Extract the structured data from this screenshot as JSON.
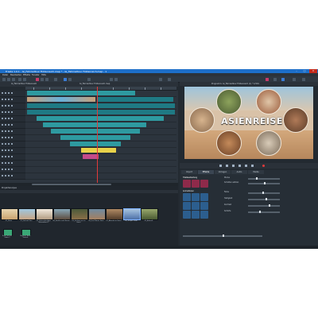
{
  "window": {
    "title": "Frieda 1.0.1 - Gi_Fahrradtour Fiddenreich.mep * - Gi_Fahrradtour Fiddenreich.mep - 1",
    "minimize": "–",
    "maximize": "□",
    "close": "✕"
  },
  "menu": [
    "Datei",
    "Bearbeiten",
    "Effekte",
    "Fenster",
    "Hilfe"
  ],
  "timeline": {
    "file_left": "Gi_Fahrradtour Fiddenreich",
    "file_center": "Gi_Fahrradtour Fiddenreich.mep"
  },
  "preview": {
    "header": "Programm: Gi_Fahrradtour Fiddenreich (1) * 1/501",
    "title_text": "ASIENREISE"
  },
  "project": {
    "title": "Projektanalyse",
    "media": [
      {
        "label": "01_Reise"
      },
      {
        "label": "02_Fahrrad Tour"
      },
      {
        "label": "03_Schneckenjäger Fahrradtour 1"
      },
      {
        "label": "04_Straße nach Hause"
      },
      {
        "label": "05_Schloss an ein Hotel"
      },
      {
        "label": "06_Dorf Mauer Fahrt"
      },
      {
        "label": "07_Abends im Hotel"
      },
      {
        "label": "08_Tempel Stadt"
      },
      {
        "label": "09_Ankunft"
      }
    ],
    "scenes": [
      {
        "label": "Ende Schnitt Video 1"
      },
      {
        "label": "Beginne Auto Schnitt"
      }
    ]
  },
  "panel": {
    "tabs": [
      "Import",
      "Effekte",
      "Vorlagen",
      "Audio",
      "Media"
    ],
    "sections": {
      "title": "Titelbearbeitung",
      "animation": "Animationen"
    },
    "text_icons": [
      {
        "icon": "text-icon",
        "label": "Text"
      },
      {
        "icon": "title-font-icon",
        "label": "Schrift"
      },
      {
        "icon": "movie-title-icon",
        "label": "Filmtitel"
      }
    ],
    "props": [
      {
        "label": "Modus"
      },
      {
        "label": "Schatten wählen"
      },
      {
        "label": "Farbe"
      },
      {
        "label": "Helligkeit"
      },
      {
        "label": "Kontrast"
      },
      {
        "label": "Schärfe"
      }
    ]
  },
  "colors": {
    "accent": "#1d6fc9",
    "timeline_clip": "#2e9aa0",
    "highlight": "#c44a8a"
  }
}
